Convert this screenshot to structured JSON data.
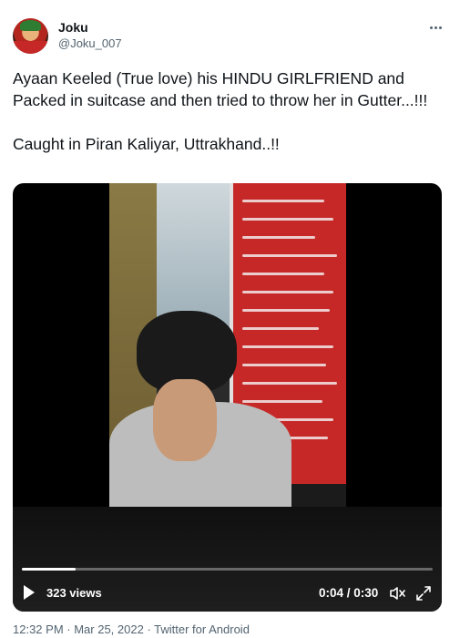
{
  "author": {
    "name": "Joku",
    "handle": "@Joku_007",
    "avatar_icon": "joker-avatar"
  },
  "tweet": {
    "text": "Ayaan Keeled (True love)  his HINDU GIRLFRIEND and Packed in suitcase and then tried to throw her in Gutter...!!!\n\nCaught in Piran Kaliyar, Uttrakhand..!!"
  },
  "video": {
    "views": "323 views",
    "time": "0:04 / 0:30",
    "progress": 0.13,
    "icons": [
      "play-icon",
      "mute-icon",
      "expand-icon"
    ]
  },
  "footer": {
    "time": "12:32 PM",
    "sep1": " · ",
    "date": "Mar 25, 2022",
    "sep2": " · ",
    "source": "Twitter for Android"
  },
  "colors": {
    "text": "#0f1419",
    "secondary": "#536471"
  }
}
